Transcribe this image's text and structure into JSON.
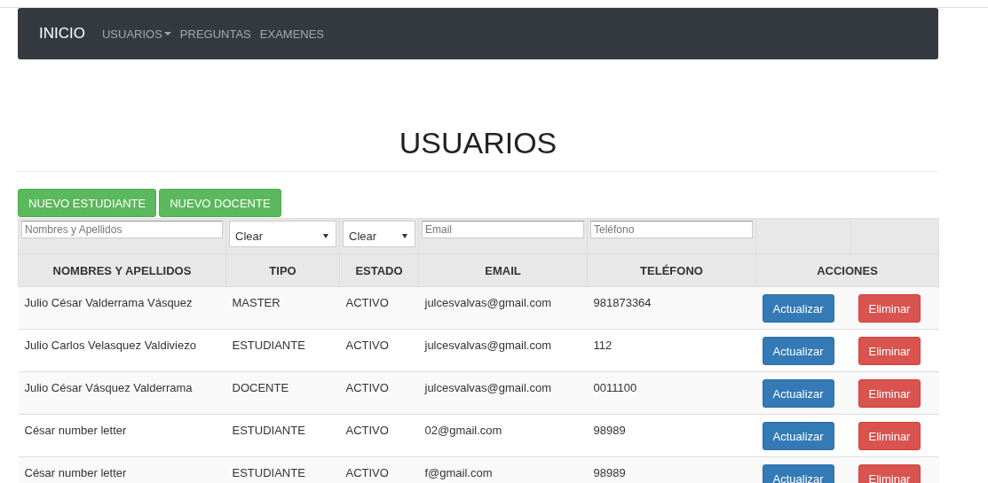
{
  "navbar": {
    "brand": "INICIO",
    "links": [
      {
        "label": "USUARIOS",
        "dropdown": true
      },
      {
        "label": "PREGUNTAS",
        "dropdown": false
      },
      {
        "label": "EXAMENES",
        "dropdown": false
      }
    ]
  },
  "page_title": "USUARIOS",
  "buttons": [
    "NUEVO ESTUDIANTE",
    "NUEVO DOCENTE"
  ],
  "table": {
    "filters": [
      {
        "kind": "text",
        "placeholder": "Nombres y Apellidos"
      },
      {
        "kind": "select",
        "value": "Clear"
      },
      {
        "kind": "select",
        "value": "Clear"
      },
      {
        "kind": "text",
        "placeholder": "Email"
      },
      {
        "kind": "text",
        "placeholder": "Teléfono"
      },
      {
        "kind": "empty"
      },
      {
        "kind": "empty"
      }
    ],
    "columns": [
      "NOMBRES Y APELLIDOS",
      "TIPO",
      "ESTADO",
      "EMAIL",
      "TELÉFONO",
      "ACCIONES"
    ],
    "rows": [
      {
        "cells": [
          "Julio César Valderrama Vásquez",
          "MASTER",
          "ACTIVO",
          "julcesvalvas@gmail.com",
          "981873364"
        ],
        "actions": [
          "Actualizar",
          "Eliminar"
        ]
      },
      {
        "cells": [
          "Julio Carlos Velasquez Valdiviezo",
          "ESTUDIANTE",
          "ACTIVO",
          "julcesvalvas@gmail.com",
          "112"
        ],
        "actions": [
          "Actualizar",
          "Eliminar"
        ]
      },
      {
        "cells": [
          "Julio César Vásquez Valderrama",
          "DOCENTE",
          "ACTIVO",
          "julcesvalvas@gmail.com",
          "0011100"
        ],
        "actions": [
          "Actualizar",
          "Eliminar"
        ]
      },
      {
        "cells": [
          "César number letter",
          "ESTUDIANTE",
          "ACTIVO",
          "02@gmail.com",
          "98989"
        ],
        "actions": [
          "Actualizar",
          "Eliminar"
        ]
      },
      {
        "cells": [
          "César number letter",
          "ESTUDIANTE",
          "ACTIVO",
          "f@gmail.com",
          "98989"
        ],
        "actions": [
          "Actualizar",
          "Eliminar"
        ]
      }
    ]
  }
}
